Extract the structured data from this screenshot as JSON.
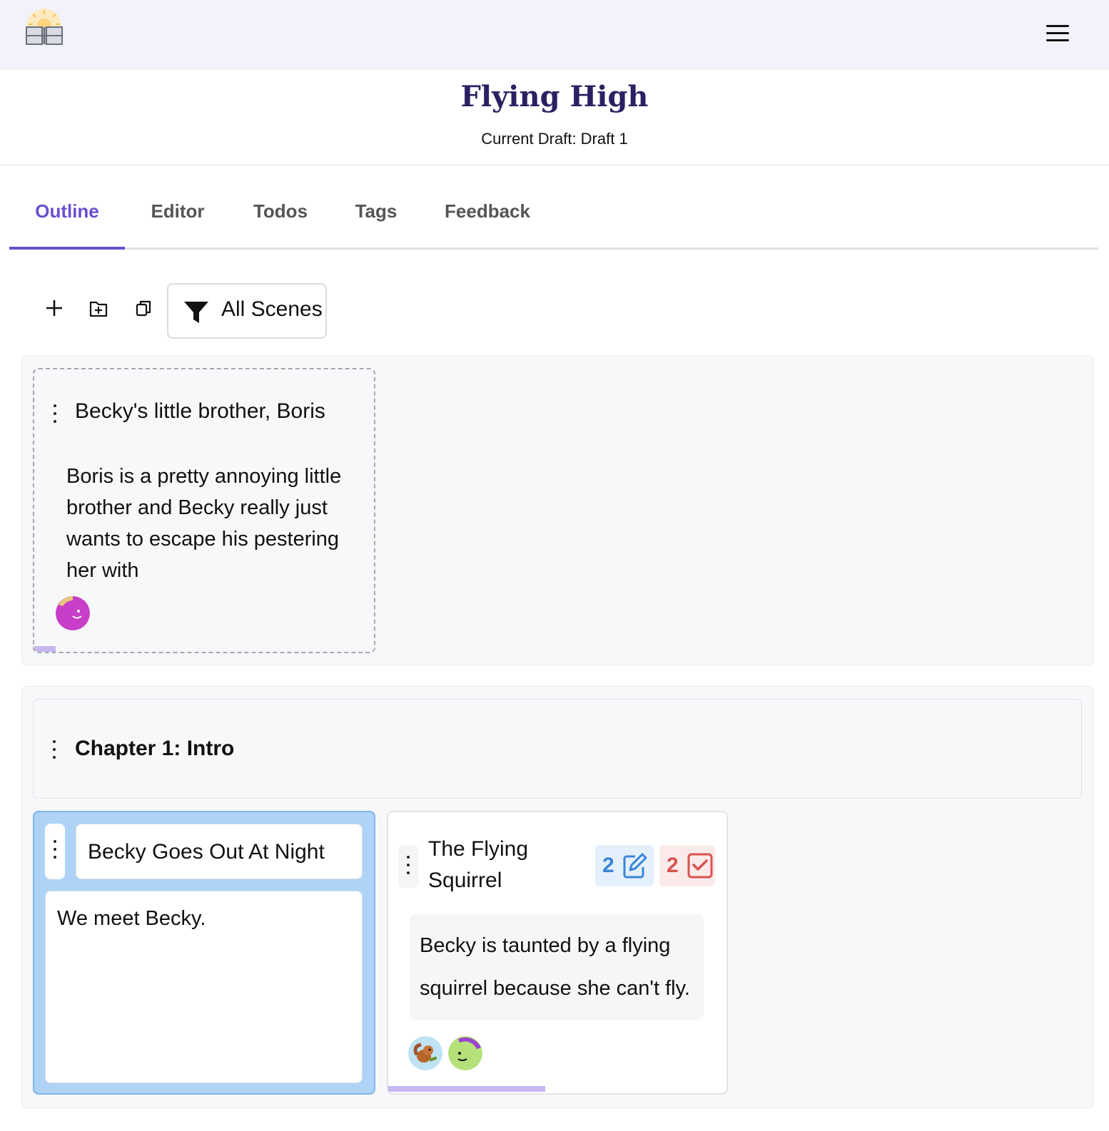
{
  "app": {
    "logo_icon": "sunrise-book-logo",
    "menu_icon": "hamburger-menu-icon"
  },
  "header": {
    "title": "Flying High",
    "draft_label": "Current Draft: Draft 1"
  },
  "tabs": [
    {
      "label": "Outline",
      "active": true
    },
    {
      "label": "Editor",
      "active": false
    },
    {
      "label": "Todos",
      "active": false
    },
    {
      "label": "Tags",
      "active": false
    },
    {
      "label": "Feedback",
      "active": false
    }
  ],
  "toolbar": {
    "add_icon": "plus-icon",
    "add_folder_icon": "folder-plus-icon",
    "copy_icon": "copy-icon",
    "filter_icon": "filter-icon",
    "filter_label": "All Scenes"
  },
  "orphan_scene": {
    "title": "Becky's little brother, Boris",
    "body": "Boris is a pretty annoying little brother and Becky really just wants to escape his pestering her with",
    "avatar_icon": "purple-smiley-avatar"
  },
  "chapter": {
    "title": "Chapter 1: Intro",
    "scenes": [
      {
        "title": "Becky Goes Out At Night",
        "body": "We meet Becky.",
        "selected": true
      },
      {
        "title": "The Flying Squirrel",
        "body": "Becky is taunted by a flying squirrel because she can't fly.",
        "notes_count": "2",
        "notes_icon": "edit-note-icon",
        "todos_count": "2",
        "todos_icon": "checkbox-icon",
        "avatars": [
          "squirrel-avatar",
          "green-smiley-avatar"
        ]
      }
    ]
  },
  "colors": {
    "accent": "#6a4fd0",
    "title": "#2a2162",
    "notes_badge": "#3a86d8",
    "todos_badge": "#d9534f"
  }
}
